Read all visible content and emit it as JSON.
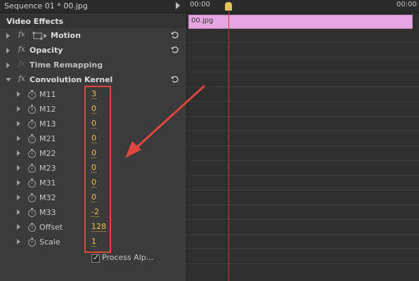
{
  "sequence_title": "Sequence 01 * 00.jpg",
  "section_title": "Video Effects",
  "effects": [
    {
      "name": "Motion",
      "fx": "fx",
      "expanded": false
    },
    {
      "name": "Opacity",
      "fx": "fx",
      "expanded": false
    },
    {
      "name": "Time Remapping",
      "fx": "fx",
      "expanded": false
    },
    {
      "name": "Convolution Kernel",
      "fx": "fx",
      "expanded": true
    }
  ],
  "parameters": [
    {
      "name": "M11",
      "value": "3"
    },
    {
      "name": "M12",
      "value": "0"
    },
    {
      "name": "M13",
      "value": "0"
    },
    {
      "name": "M21",
      "value": "0"
    },
    {
      "name": "M22",
      "value": "0"
    },
    {
      "name": "M23",
      "value": "0"
    },
    {
      "name": "M31",
      "value": "0"
    },
    {
      "name": "M32",
      "value": "0"
    },
    {
      "name": "M33",
      "value": "-2"
    },
    {
      "name": "Offset",
      "value": "128"
    },
    {
      "name": "Scale",
      "value": "1"
    }
  ],
  "process_alpha": {
    "label": "Process Alp...",
    "checked": true
  },
  "timeline": {
    "start_time": "00:00",
    "end_time": "00:00",
    "clip_label": "00.jpg"
  },
  "colors": {
    "accent": "#f0c24a",
    "clip": "#e6a6e2",
    "annotation": "#e0473e",
    "playhead": "#d03a3a"
  }
}
